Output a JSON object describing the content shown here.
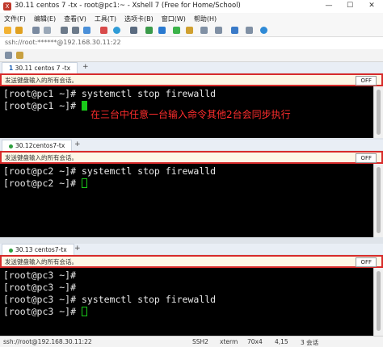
{
  "window": {
    "title": "30.11 centos 7 -tx - root@pc1:~ - Xshell 7 (Free for Home/School)",
    "minimize_symbol": "—",
    "maximize_symbol": "☐",
    "close_symbol": "✕"
  },
  "menu": [
    "文件(F)",
    "编辑(E)",
    "查看(V)",
    "工具(T)",
    "选项卡(B)",
    "窗口(W)",
    "帮助(H)"
  ],
  "address": {
    "text": "ssh://root:******@192.168.30.11:22"
  },
  "sessions": [
    {
      "tab_label": "30.11 centos 7 -tx",
      "tab_number": "1",
      "tab_add": "+",
      "send_label": "发送键盘输入的所有会话。",
      "send_toggle": "OFF",
      "lines": [
        "[root@pc1 ~]# systemctl stop firewalld",
        "[root@pc1 ~]# "
      ],
      "note": "在三台中任意一台输入命令其他2台会同步执行"
    },
    {
      "tab_label": "30.12centos7-tx",
      "tab_add": "+",
      "send_label": "发送键盘输入的所有会话。",
      "send_toggle": "OFF",
      "lines": [
        "[root@pc2 ~]# systemctl stop firewalld",
        "[root@pc2 ~]# "
      ]
    },
    {
      "tab_label": "30.13 centos7-tx",
      "tab_add": "+",
      "send_label": "发送键盘输入的所有会话。",
      "send_toggle": "OFF",
      "lines": [
        "[root@pc3 ~]# ",
        "[root@pc3 ~]# ",
        "[root@pc3 ~]# systemctl stop firewalld",
        "[root@pc3 ~]# "
      ]
    }
  ],
  "status": {
    "connection": "ssh://root@192.168.30.11:22",
    "protocol": "SSH2",
    "terminal": "xterm",
    "size": "70x4",
    "cursor": "4,15",
    "sessions": "3 会话"
  },
  "colors": {
    "terminal_bg": "#000000",
    "prompt_text": "#e6e6e6",
    "cursor": "#19c919",
    "note": "#ff2d2d",
    "highlight_border": "#d72b2b"
  }
}
